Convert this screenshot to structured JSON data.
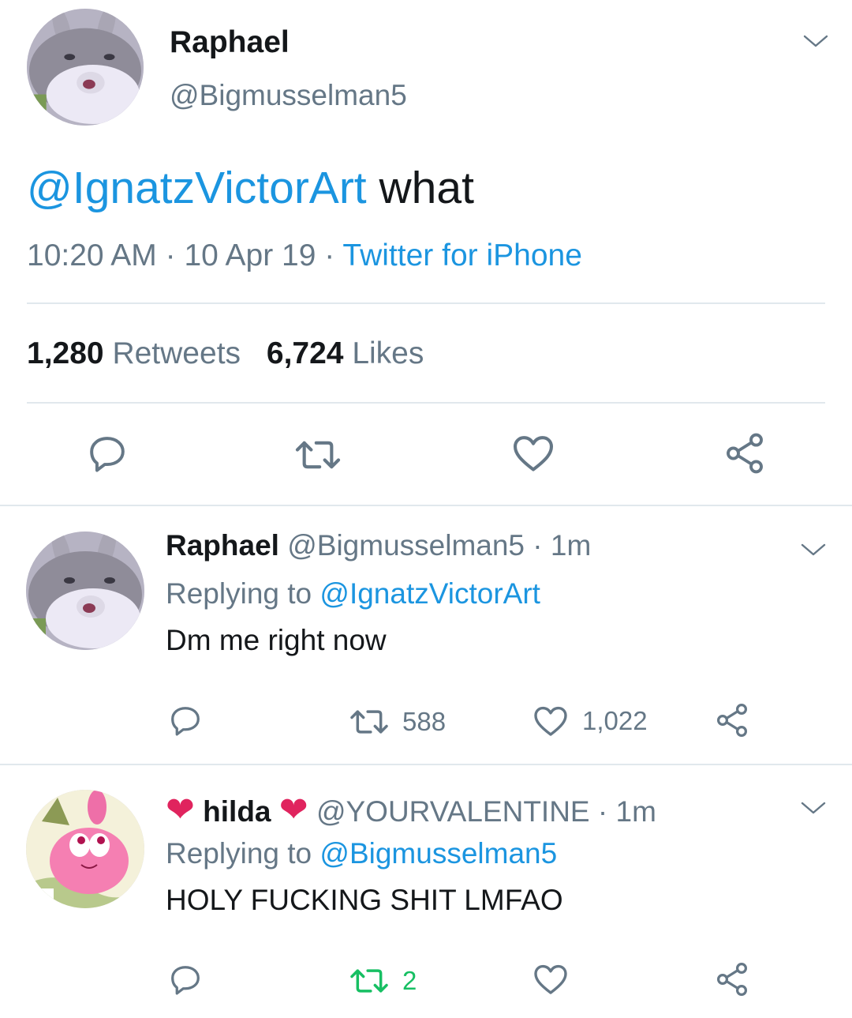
{
  "main_tweet": {
    "display_name": "Raphael",
    "handle": "@Bigmusselman5",
    "mention": "@IgnatzVictorArt",
    "text": "what",
    "time": "10:20 AM",
    "sep1": "·",
    "date": "10 Apr 19",
    "sep2": "·",
    "source": "Twitter for iPhone",
    "retweets_count": "1,280",
    "retweets_label": "Retweets",
    "likes_count": "6,724",
    "likes_label": "Likes"
  },
  "reply1": {
    "display_name": "Raphael",
    "handle": "@Bigmusselman5",
    "dot": "·",
    "age": "1m",
    "replying_prefix": "Replying to",
    "replying_to": "@IgnatzVictorArt",
    "text": "Dm me right now",
    "retweet_count": "588",
    "like_count": "1,022"
  },
  "reply2": {
    "name_prefix_emoji": "❤",
    "display_name": "hilda",
    "name_suffix_emoji": "❤",
    "handle": "@YOURVALENTINE",
    "dot": "·",
    "age": "1m",
    "replying_prefix": "Replying to",
    "replying_to": "@Bigmusselman5",
    "text": "HOLY FUCKING SHIT LMFAO",
    "retweet_count": "2"
  },
  "colors": {
    "link": "#1b95e0",
    "secondary": "#657786",
    "divider": "#e1e8ed",
    "retweeted": "#17bf63",
    "heart_emoji": "#e0245e"
  },
  "icons": [
    "reply-icon",
    "retweet-icon",
    "like-icon",
    "share-icon",
    "chevron-down-icon",
    "heart-emoji-icon"
  ]
}
